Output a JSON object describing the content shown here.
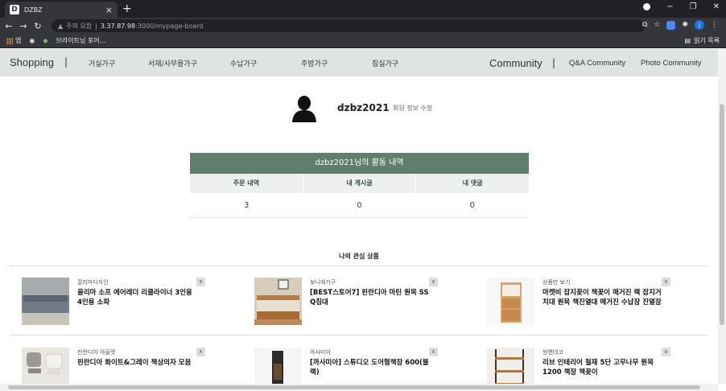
{
  "browser": {
    "tab_title": "DZBZ",
    "tab_close": "×",
    "new_tab": "+",
    "url_warning": "주의 요함",
    "url_sep": "|",
    "url_host": "3.37.87.98",
    "url_rest": ":3000/mypage-board",
    "bookmark_apps": "앱",
    "bookmark_2": "브라이트닝 포어...",
    "reading_list": "읽기 목록",
    "profile_initial": "j",
    "win_min": "−",
    "win_restore": "❐",
    "win_close": "✕"
  },
  "nav": {
    "shopping": "Shopping",
    "sep": "|",
    "links": [
      "거실가구",
      "서재/사무용가구",
      "수납가구",
      "주방가구",
      "침실가구"
    ],
    "community": "Community",
    "qa": "Q&A Community",
    "photo": "Photo Community"
  },
  "profile": {
    "username": "dzbz2021",
    "edit": "회원 정보 수정"
  },
  "activity": {
    "title": "dzbz2021님의 활동 내역",
    "headers": [
      "주문 내역",
      "내 게시글",
      "내 댓글"
    ],
    "values": [
      "3",
      "0",
      "0"
    ]
  },
  "wishlist": {
    "title": "나의 관심 상품",
    "remove": "x",
    "items": [
      {
        "brand": "끌리마디자인",
        "name": "끌리마 소프 에어레더 리클라이너 3인용 4인용 소파"
      },
      {
        "brand": "보니애가구",
        "name": "[BEST스토어7] 핀란디아 마틴 원목 SS Q침대"
      },
      {
        "brand": "상품만 보기",
        "name": "마켓비 잡지꽂이 책꽂이 매거진 랙 잡지거치대 원목 책진열대 메거진 수납장 진열장"
      },
      {
        "brand": "핀란디아 아울렛",
        "name": "핀란디아 화이트&그레이 책상의자 모음"
      },
      {
        "brand": "까사미아",
        "name": "[까사미아] 스튜디오 도어형책장 600(블랙)"
      },
      {
        "brand": "씽앤데코",
        "name": "리브 인테리어 철재 5단 고무나무 원목 1200 책장 책꽂이"
      }
    ]
  }
}
